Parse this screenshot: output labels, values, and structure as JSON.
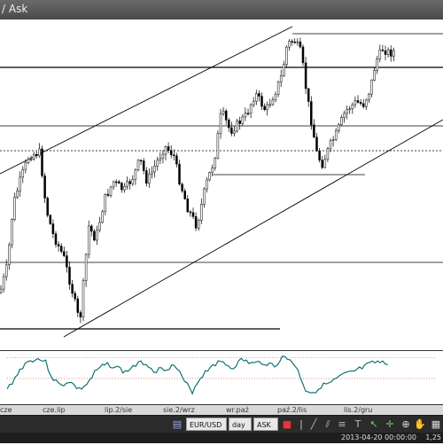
{
  "window": {
    "title": "/ Ask"
  },
  "xaxis": {
    "labels": [
      "cze",
      "cze.lip",
      "lip.2/sie",
      "sie.2/wrz",
      "wr.paź",
      "paź.2/lis",
      "lis.2/gru"
    ]
  },
  "toolbar": {
    "symbol": "EUR/USD",
    "timeframe": "day",
    "price_type": "ASK"
  },
  "status": {
    "datetime": "2013-04-20 00:00:00",
    "price": "1,25"
  },
  "colors": {
    "candle": "#000000",
    "oscillator": "#0a6e72",
    "levels": "#cc3333",
    "toolbar_bg": "#2b2b2b"
  }
}
